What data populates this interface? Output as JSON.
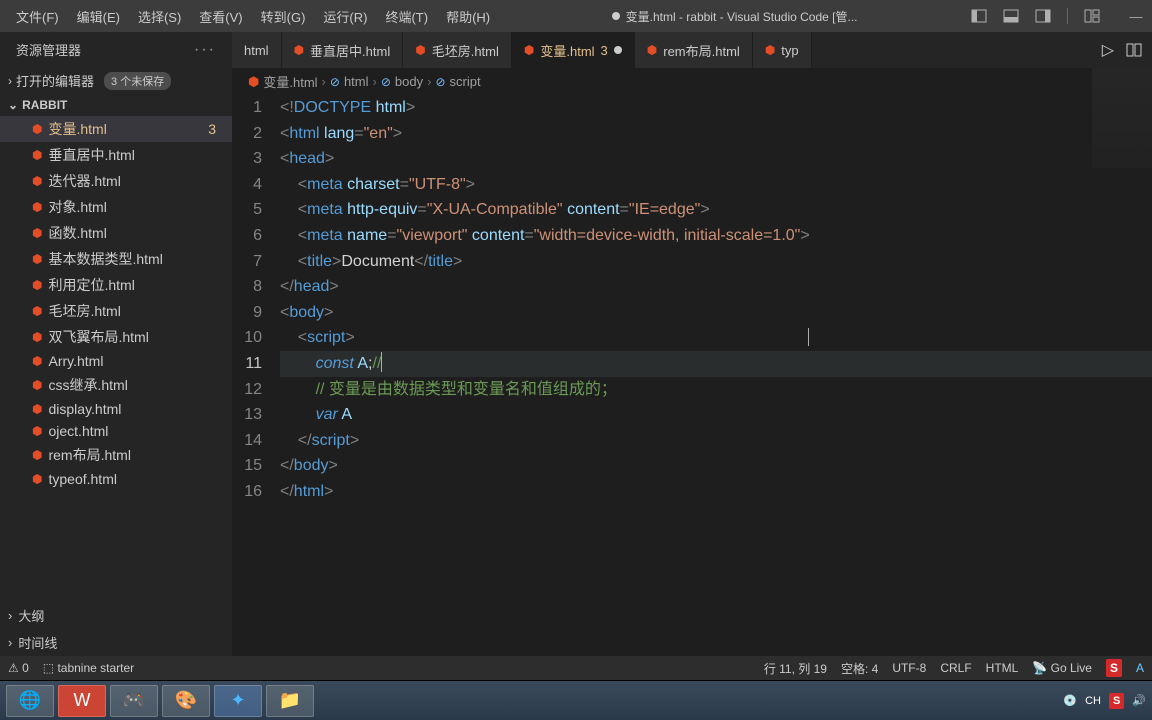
{
  "menubar": [
    "文件(F)",
    "编辑(E)",
    "选择(S)",
    "查看(V)",
    "转到(G)",
    "运行(R)",
    "终端(T)",
    "帮助(H)"
  ],
  "window_title": "变量.html - rabbit - Visual Studio Code [管...",
  "explorer": {
    "title": "资源管理器",
    "open_editors": "打开的编辑器",
    "unsaved_badge": "3 个未保存",
    "project": "RABBIT",
    "files": [
      {
        "name": "变量.html",
        "active": true,
        "count": "3"
      },
      {
        "name": "垂直居中.html"
      },
      {
        "name": "迭代器.html"
      },
      {
        "name": "对象.html"
      },
      {
        "name": "函数.html"
      },
      {
        "name": "基本数据类型.html"
      },
      {
        "name": "利用定位.html"
      },
      {
        "name": "毛坯房.html"
      },
      {
        "name": "双飞翼布局.html"
      },
      {
        "name": "Arry.html"
      },
      {
        "name": "css继承.html"
      },
      {
        "name": "display.html"
      },
      {
        "name": "oject.html"
      },
      {
        "name": "rem布局.html"
      },
      {
        "name": "typeof.html"
      }
    ],
    "outline": "大纲",
    "timeline": "时间线"
  },
  "tabs": [
    {
      "label": "html",
      "partial": true
    },
    {
      "label": "垂直居中.html"
    },
    {
      "label": "毛坯房.html"
    },
    {
      "label": "变量.html",
      "active": true,
      "modified": true,
      "count": "3"
    },
    {
      "label": "rem布局.html"
    },
    {
      "label": "typ",
      "partial": true
    }
  ],
  "breadcrumb": [
    "变量.html",
    "html",
    "body",
    "script"
  ],
  "code": {
    "title_text": "Document",
    "comment": "// 变量是由数据类型和变量名和值组成的；",
    "var_name": "A"
  },
  "statusbar": {
    "warnings": "0",
    "tabnine": "tabnine starter",
    "cursor": "行 11, 列 19",
    "spaces": "空格: 4",
    "encoding": "UTF-8",
    "eol": "CRLF",
    "lang": "HTML",
    "golive": "Go Live"
  },
  "ime": "S",
  "ime_text": "A"
}
